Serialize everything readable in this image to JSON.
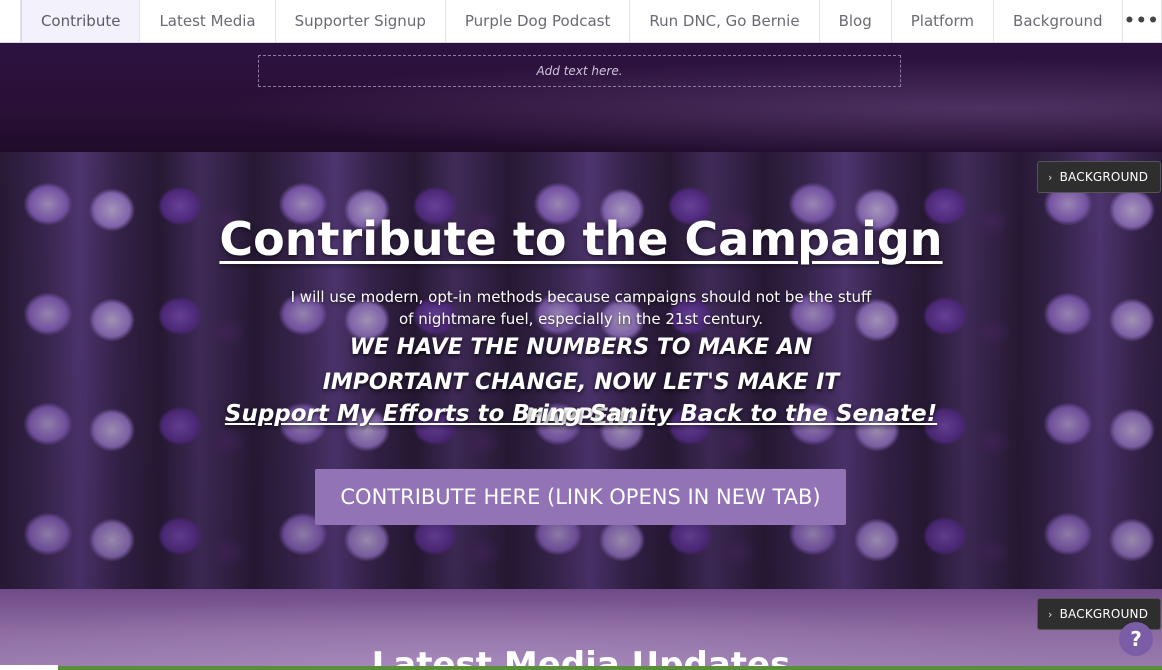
{
  "nav": {
    "items": [
      {
        "label": "Contribute",
        "active": true
      },
      {
        "label": "Latest Media"
      },
      {
        "label": "Supporter Signup"
      },
      {
        "label": "Purple Dog Podcast"
      },
      {
        "label": "Run DNC, Go Bernie"
      },
      {
        "label": "Blog"
      },
      {
        "label": "Platform"
      },
      {
        "label": "Background"
      }
    ],
    "more_label": "•••"
  },
  "top_band": {
    "placeholder_text": "Add text here."
  },
  "hero": {
    "title": "Contribute to the Campaign",
    "subtitle": "I will use modern, opt-in methods because campaigns should not be the stuff of nightmare fuel, especially in the 21st century.",
    "bold_line": "WE HAVE THE NUMBERS TO MAKE AN IMPORTANT CHANGE, NOW LET'S MAKE IT HAPPEN!",
    "link_text": "Support My Efforts to Bring Sanity Back to the Senate!",
    "cta_label": "CONTRIBUTE HERE (LINK OPENS IN NEW TAB)",
    "background_button": "BACKGROUND",
    "accent_color": "#9273b6"
  },
  "bottom": {
    "title": "Latest Media Updates",
    "background_button": "BACKGROUND"
  },
  "help": {
    "label": "?"
  }
}
